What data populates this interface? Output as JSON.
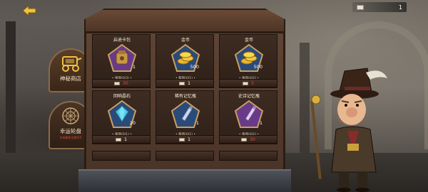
{
  "header": {
    "back_icon": "back-arrow-icon",
    "currency": {
      "icon": "ticket-icon",
      "amount": "1"
    }
  },
  "side_menu": {
    "items": [
      {
        "label": "神秘商店",
        "sub": "",
        "icon": "carriage-icon",
        "active": true
      },
      {
        "label": "幸运轮盘",
        "sub": "本周剩余次数0/5",
        "icon": "wheel-icon",
        "active": false
      }
    ]
  },
  "shop": {
    "items": [
      {
        "name": "启迪卡包",
        "qty": "1",
        "limit": "• 每周(0/3) •",
        "price": "30",
        "price_red": true,
        "icon": "card-pack-icon",
        "frame_color": "#6a3a8a"
      },
      {
        "name": "金币",
        "qty": "500",
        "limit": "• 每周(0/1) •",
        "price": "1",
        "price_red": false,
        "icon": "gold-coins-icon",
        "frame_color": "#2a4a7a"
      },
      {
        "name": "金币",
        "qty": "500",
        "limit": "• 每周(0/2) •",
        "price": "5",
        "price_red": true,
        "icon": "gold-coins-icon",
        "frame_color": "#2a4a7a"
      },
      {
        "name": "回响晶石",
        "qty": "20",
        "limit": "• 每周(0/1) •",
        "price": "1",
        "price_red": false,
        "icon": "echo-crystal-icon",
        "frame_color": "#2a4a7a"
      },
      {
        "name": "稀有记忆瓶",
        "qty": "1",
        "limit": "• 每周(0/1) •",
        "price": "1",
        "price_red": false,
        "icon": "memory-bottle-icon",
        "frame_color": "#2a4a7a"
      },
      {
        "name": "史诗记忆瓶",
        "qty": "1",
        "limit": "• 每周(0/2) •",
        "price": "30",
        "price_red": true,
        "icon": "memory-bottle-icon",
        "frame_color": "#6a3a8a"
      }
    ]
  },
  "colors": {
    "accent_red": "#e8443a",
    "wood": "#4a3428",
    "epic_purple": "#6a3a8a",
    "rare_blue": "#2a4a7a"
  }
}
